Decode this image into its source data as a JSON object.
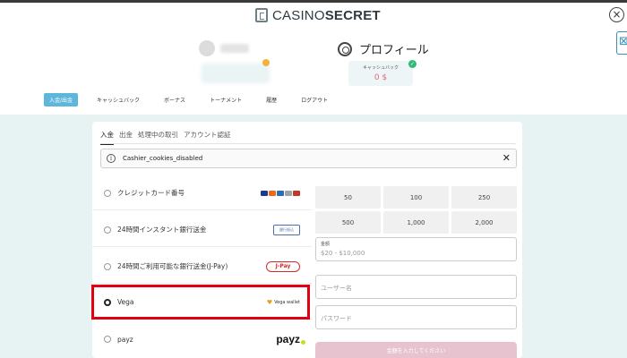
{
  "header": {
    "logo": {
      "prefix": "CASINO",
      "suffix": "SECRET"
    },
    "close_icon": "×",
    "side_icon": "⊠",
    "profile_label": "プロフィール",
    "cashback": {
      "label": "キャッシュバック",
      "value": "0 $"
    },
    "check_icon": "✓"
  },
  "nav": {
    "items": [
      {
        "label": "入金/出金",
        "active": true
      },
      {
        "label": "キャッシュバック"
      },
      {
        "label": "ボーナス"
      },
      {
        "label": "トーナメント"
      },
      {
        "label": "履歴"
      },
      {
        "label": "ログアウト"
      }
    ]
  },
  "tabs": [
    "入金",
    "出金",
    "処理中の取引",
    "アカウント認証"
  ],
  "notice": {
    "icon": "i",
    "text": "Cashier_cookies_disabled",
    "close": "✕"
  },
  "methods": [
    {
      "label": "クレジットカード番号",
      "selected": false,
      "logo": "card-logos"
    },
    {
      "label": "24時間インスタント銀行送金",
      "selected": false,
      "logo": "bank-transfer",
      "logo_text": "銀行振込"
    },
    {
      "label": "24時間ご利用可能な銀行送金(J-Pay)",
      "selected": false,
      "logo": "jpay",
      "logo_text": "J-Pay"
    },
    {
      "label": "Vega",
      "selected": true,
      "logo": "vega-wallet",
      "logo_text": "Vega wallet"
    },
    {
      "label": "payz",
      "selected": false,
      "logo": "payz",
      "logo_text": "payz"
    }
  ],
  "amounts": [
    "50",
    "100",
    "250",
    "500",
    "1,000",
    "2,000"
  ],
  "form": {
    "amount_label": "金額",
    "amount_placeholder": "$20 - $10,000",
    "username_placeholder": "ユーザー名",
    "password_placeholder": "パスワード",
    "submit_label": "金額を入力してください"
  },
  "colors": {
    "accent": "#5fb6db",
    "highlight": "#e00010",
    "cashback_value": "#e06a7d",
    "submit": "#e7c3cf"
  }
}
